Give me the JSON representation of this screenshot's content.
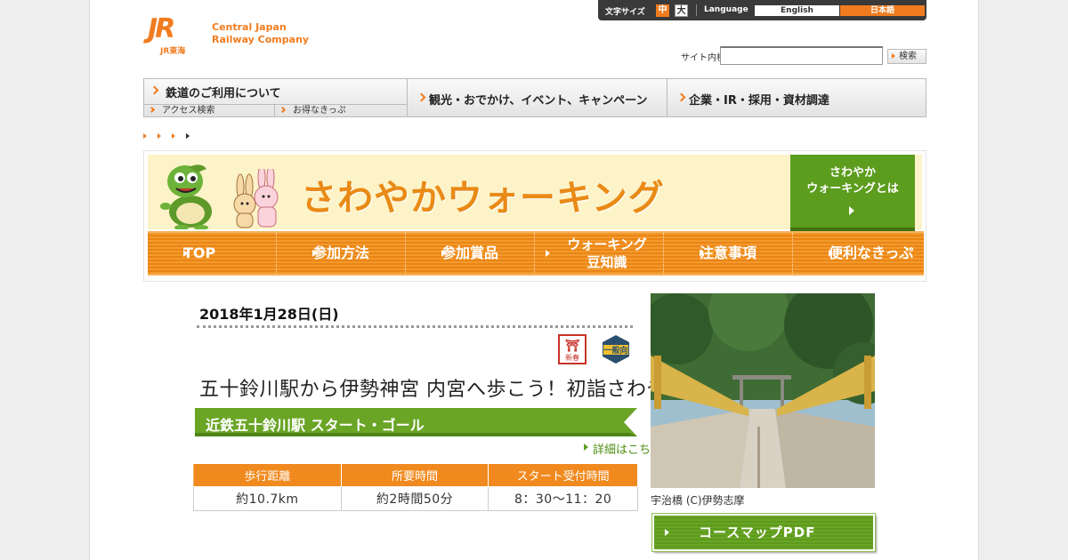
{
  "header": {
    "logo_mark": "JR",
    "logo_sub": "JR東海",
    "company_line1": "Central Japan",
    "company_line2": "Railway Company"
  },
  "utility_bar": {
    "text_size_label": "文字サイズ",
    "size_medium": "中",
    "size_large": "大",
    "language_label": "Language",
    "lang_english": "English",
    "lang_japanese": "日本語"
  },
  "search": {
    "label": "サイト内検索",
    "placeholder": "",
    "button_label": "検索"
  },
  "global_nav": {
    "railway": "鉄道のご利用について",
    "access_search": "アクセス検索",
    "value_tickets": "お得なきっぷ",
    "tourism": "観光・おでかけ、イベント、キャンペーン",
    "corporate": "企業・IR・採用・資材調達"
  },
  "banner": {
    "title": "さわやかウォーキング",
    "about_line1": "さわやか",
    "about_line2": "ウォーキングとは",
    "nav": [
      {
        "label": "TOP"
      },
      {
        "label": "参加方法"
      },
      {
        "label": "参加賞品"
      },
      {
        "label_line1": "ウォーキング",
        "label_line2": "豆知識"
      },
      {
        "label": "注意事項"
      },
      {
        "label": "便利なきっぷ"
      }
    ]
  },
  "event": {
    "date": "2018年1月28日(日)",
    "stamp_icon_label": "新春",
    "level_icon_label": "一般向",
    "title": "五十鈴川駅から伊勢神宮 内宮へ歩こう！初詣さわやかウォーキング",
    "station": "近鉄五十鈴川駅 スタート・ゴール",
    "detail_link": "詳細はこちら",
    "table": {
      "headers": [
        "歩行距離",
        "所要時間",
        "スタート受付時間"
      ],
      "values": [
        "約10.7km",
        "約2時間50分",
        "8：30～11：20"
      ]
    },
    "photo_caption": "宇治橋 (C)伊勢志摩",
    "pdf_button": "コースマップPDF"
  },
  "colors": {
    "brand_orange": "#f07c1f",
    "walking_green": "#5c9d1e",
    "banner_yellow": "#fdf3c8"
  }
}
